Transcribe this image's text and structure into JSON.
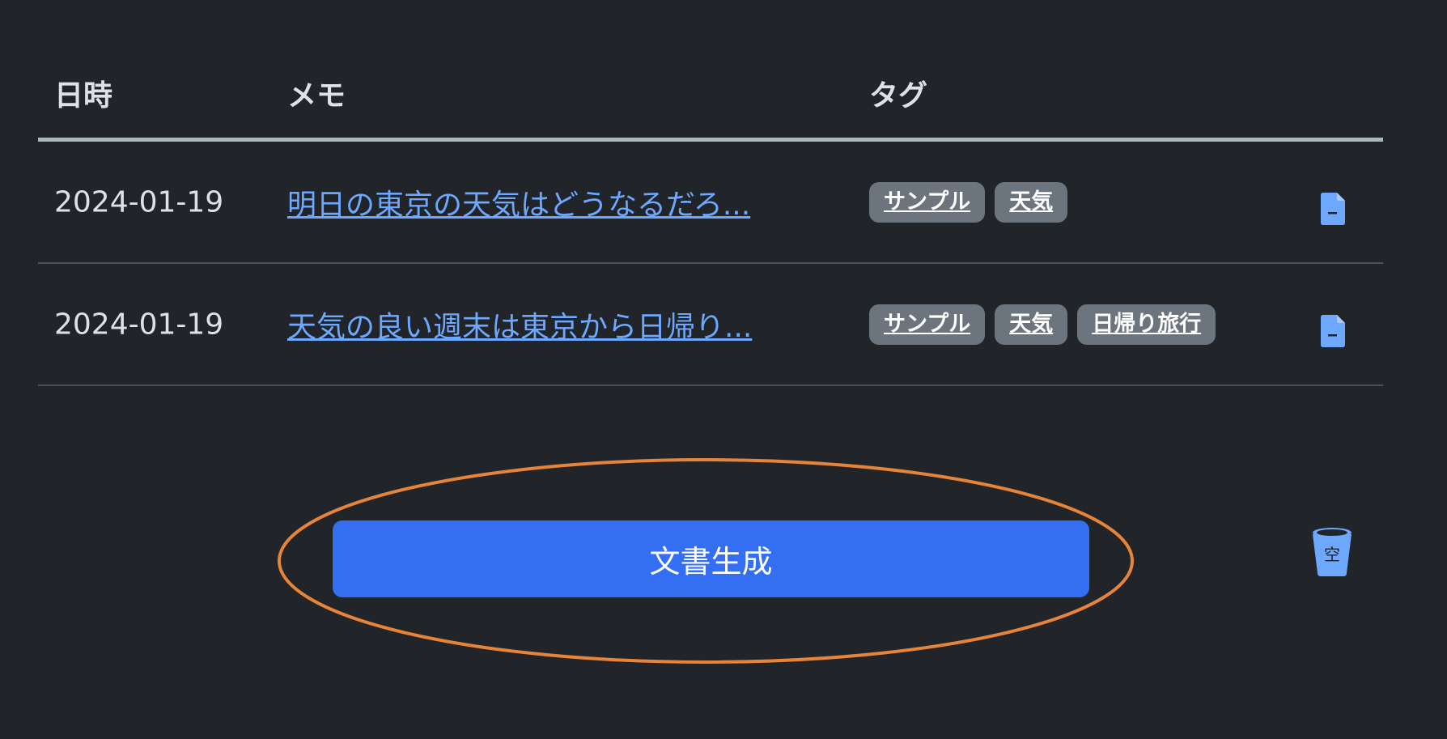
{
  "table": {
    "headers": {
      "date": "日時",
      "memo": "メモ",
      "tags": "タグ"
    },
    "rows": [
      {
        "date": "2024-01-19",
        "memo": "明日の東京の天気はどうなるだろ...",
        "tags": [
          "サンプル",
          "天気"
        ],
        "action_icon": "document-icon"
      },
      {
        "date": "2024-01-19",
        "memo": "天気の良い週末は東京から日帰り...",
        "tags": [
          "サンプル",
          "天気",
          "日帰り旅行"
        ],
        "action_icon": "document-icon"
      }
    ]
  },
  "actions": {
    "generate_label": "文書生成",
    "trash_label": "空",
    "trash_icon": "trash-icon"
  },
  "colors": {
    "background": "#212529",
    "primary": "#346ef2",
    "link": "#6ea8fe",
    "tag_bg": "#6c757d",
    "highlight": "#e8843a"
  }
}
